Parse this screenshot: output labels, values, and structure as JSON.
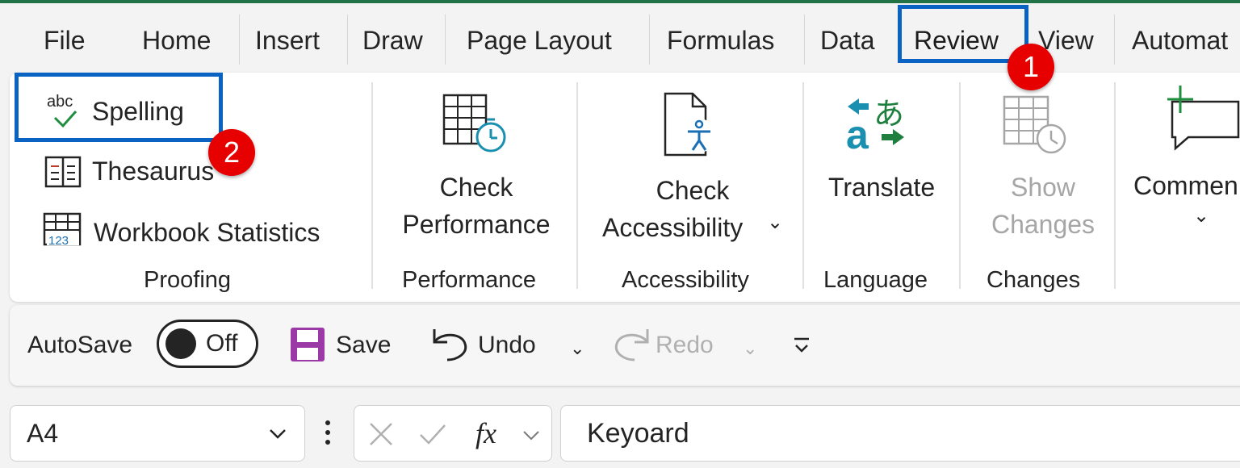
{
  "tabs": [
    "File",
    "Home",
    "Insert",
    "Draw",
    "Page Layout",
    "Formulas",
    "Data",
    "Review",
    "View",
    "Automat"
  ],
  "active_tab": "Review",
  "annotations": {
    "badge1": "1",
    "badge2": "2",
    "highlight_color": "#0a62c2",
    "badge_color": "#e60000"
  },
  "proofing": {
    "spelling": "Spelling",
    "spelling_icon_text": "abc",
    "thesaurus": "Thesaurus",
    "workbook_statistics": "Workbook Statistics",
    "label": "Proofing"
  },
  "performance": {
    "line1": "Check",
    "line2": "Performance",
    "label": "Performance"
  },
  "accessibility": {
    "line1": "Check",
    "line2": "Accessibility",
    "chevron": "⌄",
    "label": "Accessibility"
  },
  "language": {
    "button": "Translate",
    "label": "Language"
  },
  "changes": {
    "line1": "Show",
    "line2": "Changes",
    "label": "Changes"
  },
  "comments": {
    "button": "Commen",
    "chevron": "⌄"
  },
  "qat": {
    "autosave": "AutoSave",
    "toggle_state": "Off",
    "save": "Save",
    "undo": "Undo",
    "redo": "Redo",
    "chevron": "⌄"
  },
  "formula_bar": {
    "name_box": "A4",
    "formula": "Keyoard",
    "fx": "fx"
  },
  "colors": {
    "excel_green": "#217346",
    "translate_teal": "#1a8fb0",
    "save_purple": "#9b3aa6"
  }
}
